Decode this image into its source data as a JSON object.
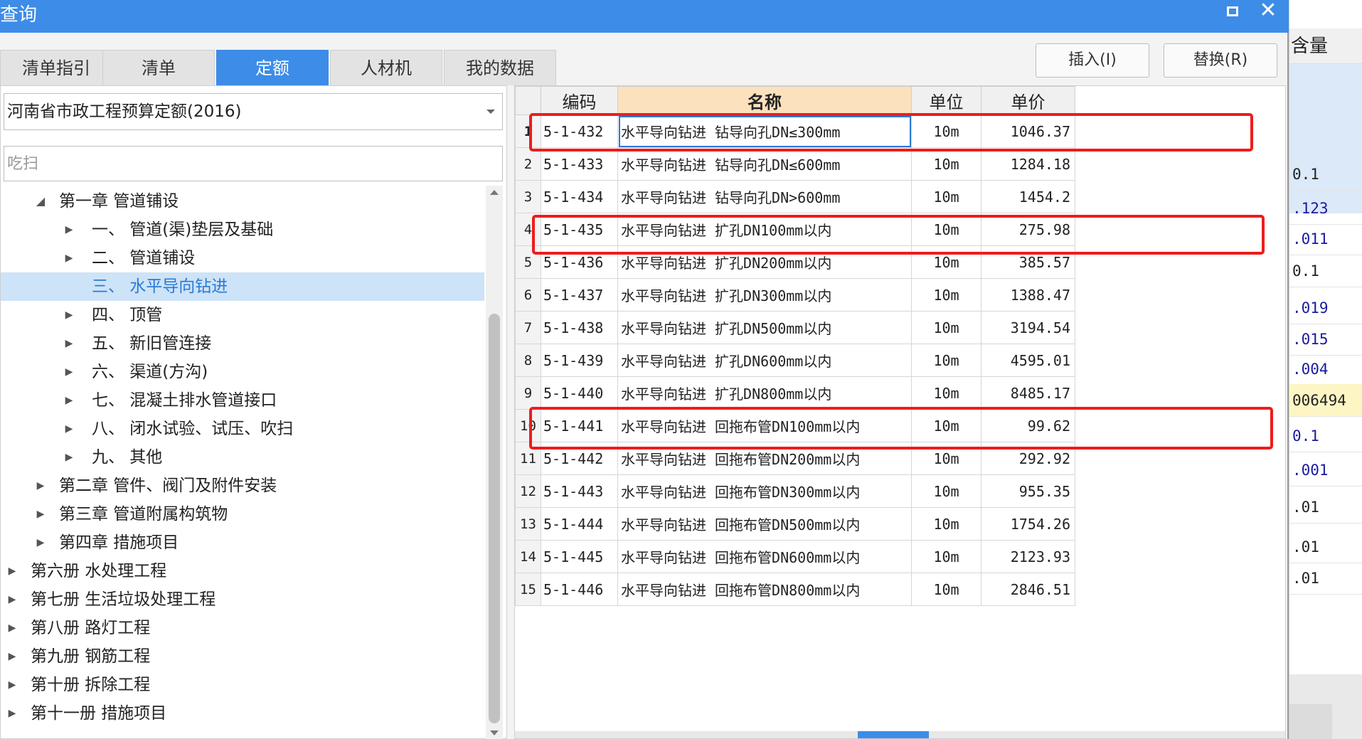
{
  "window": {
    "title": "查询"
  },
  "tabs": [
    {
      "label": "清单指引",
      "active": false
    },
    {
      "label": "清单",
      "active": false
    },
    {
      "label": "定额",
      "active": true
    },
    {
      "label": "人材机",
      "active": false
    },
    {
      "label": "我的数据",
      "active": false
    }
  ],
  "toolbar": {
    "insert_label": "插入(I)",
    "replace_label": "替换(R)"
  },
  "left": {
    "quota_select": "河南省市政工程预算定额(2016)",
    "search_placeholder": "吃扫",
    "tree": [
      {
        "label": "第一章 管道铺设",
        "level": 1,
        "expanded": true
      },
      {
        "label": "一、 管道(渠)垫层及基础",
        "level": 2
      },
      {
        "label": "二、 管道铺设",
        "level": 2
      },
      {
        "label": "三、 水平导向钻进",
        "level": 2,
        "selected": true
      },
      {
        "label": "四、 顶管",
        "level": 2
      },
      {
        "label": "五、 新旧管连接",
        "level": 2
      },
      {
        "label": "六、 渠道(方沟)",
        "level": 2
      },
      {
        "label": "七、 混凝土排水管道接口",
        "level": 2
      },
      {
        "label": "八、 闭水试验、试压、吹扫",
        "level": 2
      },
      {
        "label": "九、 其他",
        "level": 2
      },
      {
        "label": "第二章 管件、阀门及附件安装",
        "level": 1
      },
      {
        "label": "第三章 管道附属构筑物",
        "level": 1
      },
      {
        "label": "第四章 措施项目",
        "level": 1
      },
      {
        "label": "第六册 水处理工程",
        "level": 0
      },
      {
        "label": "第七册 生活垃圾处理工程",
        "level": 0
      },
      {
        "label": "第八册 路灯工程",
        "level": 0
      },
      {
        "label": "第九册 钢筋工程",
        "level": 0
      },
      {
        "label": "第十册 拆除工程",
        "level": 0
      },
      {
        "label": "第十一册 措施项目",
        "level": 0
      }
    ]
  },
  "grid": {
    "columns": [
      "",
      "编码",
      "名称",
      "单位",
      "单价"
    ],
    "rows": [
      {
        "idx": "1",
        "code": "5-1-432",
        "name": "水平导向钻进 钻导向孔DN≤300mm",
        "unit": "10m",
        "price": "1046.37"
      },
      {
        "idx": "2",
        "code": "5-1-433",
        "name": "水平导向钻进 钻导向孔DN≤600mm",
        "unit": "10m",
        "price": "1284.18"
      },
      {
        "idx": "3",
        "code": "5-1-434",
        "name": "水平导向钻进 钻导向孔DN>600mm",
        "unit": "10m",
        "price": "1454.2"
      },
      {
        "idx": "4",
        "code": "5-1-435",
        "name": "水平导向钻进 扩孔DN100mm以内",
        "unit": "10m",
        "price": "275.98"
      },
      {
        "idx": "5",
        "code": "5-1-436",
        "name": "水平导向钻进 扩孔DN200mm以内",
        "unit": "10m",
        "price": "385.57"
      },
      {
        "idx": "6",
        "code": "5-1-437",
        "name": "水平导向钻进 扩孔DN300mm以内",
        "unit": "10m",
        "price": "1388.47"
      },
      {
        "idx": "7",
        "code": "5-1-438",
        "name": "水平导向钻进 扩孔DN500mm以内",
        "unit": "10m",
        "price": "3194.54"
      },
      {
        "idx": "8",
        "code": "5-1-439",
        "name": "水平导向钻进 扩孔DN600mm以内",
        "unit": "10m",
        "price": "4595.01"
      },
      {
        "idx": "9",
        "code": "5-1-440",
        "name": "水平导向钻进 扩孔DN800mm以内",
        "unit": "10m",
        "price": "8485.17"
      },
      {
        "idx": "10",
        "code": "5-1-441",
        "name": "水平导向钻进 回拖布管DN100mm以内",
        "unit": "10m",
        "price": "99.62"
      },
      {
        "idx": "11",
        "code": "5-1-442",
        "name": "水平导向钻进 回拖布管DN200mm以内",
        "unit": "10m",
        "price": "292.92"
      },
      {
        "idx": "12",
        "code": "5-1-443",
        "name": "水平导向钻进 回拖布管DN300mm以内",
        "unit": "10m",
        "price": "955.35"
      },
      {
        "idx": "13",
        "code": "5-1-444",
        "name": "水平导向钻进 回拖布管DN500mm以内",
        "unit": "10m",
        "price": "1754.26"
      },
      {
        "idx": "14",
        "code": "5-1-445",
        "name": "水平导向钻进 回拖布管DN600mm以内",
        "unit": "10m",
        "price": "2123.93"
      },
      {
        "idx": "15",
        "code": "5-1-446",
        "name": "水平导向钻进 回拖布管DN800mm以内",
        "unit": "10m",
        "price": "2846.51"
      }
    ]
  },
  "background_window": {
    "header": "含量",
    "values": [
      "0.1",
      ".123",
      ".011",
      "0.1",
      ".019",
      ".015",
      ".004",
      "006494",
      "0.1",
      ".001",
      ".01",
      ".01",
      ".01"
    ]
  },
  "colors": {
    "accent": "#3d8ce8",
    "highlight_box": "#ee1c1c",
    "name_header": "#fce1bd"
  }
}
